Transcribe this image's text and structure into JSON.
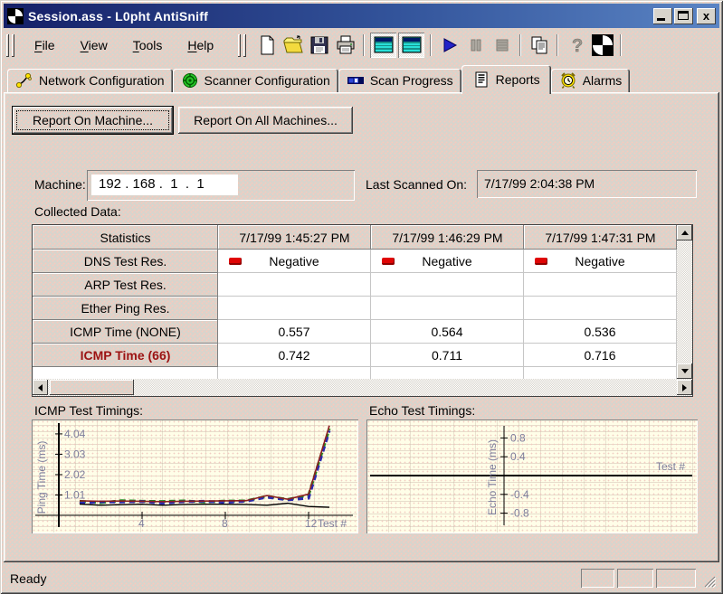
{
  "window": {
    "title": "Session.ass - L0pht AntiSniff",
    "status_ready": "Ready"
  },
  "titlebar": {
    "buttons": [
      "minimize",
      "maximize",
      "close"
    ]
  },
  "menu": {
    "items": [
      "File",
      "View",
      "Tools",
      "Help"
    ]
  },
  "toolbar": {
    "buttons": [
      "new-file",
      "open-file",
      "save-file",
      "print",
      "machine-view-left",
      "machine-view-right",
      "start-scan",
      "pause-scan",
      "stop-scan",
      "copy-report",
      "help",
      "l0pht-logo"
    ]
  },
  "tabs": [
    {
      "label": "Network Configuration",
      "icon": "network-icon",
      "active": false
    },
    {
      "label": "Scanner Configuration",
      "icon": "scanner-icon",
      "active": false
    },
    {
      "label": "Scan Progress",
      "icon": "progress-icon",
      "active": false
    },
    {
      "label": "Reports",
      "icon": "reports-icon",
      "active": true
    },
    {
      "label": "Alarms",
      "icon": "alarm-icon",
      "active": false
    }
  ],
  "reports_tab": {
    "report_on_machine": "Report On Machine...",
    "report_on_all": "Report On All Machines...",
    "machine_label": "Machine:",
    "machine_ip": "192 . 168 .  1  .  1",
    "last_scanned_label": "Last Scanned On:",
    "last_scanned_value": "7/17/99 2:04:38 PM",
    "collected_data_label": "Collected Data:"
  },
  "table": {
    "headers": [
      "Statistics",
      "7/17/99 1:45:27 PM",
      "7/17/99 1:46:29 PM",
      "7/17/99 1:47:31 PM"
    ],
    "rows": [
      {
        "label": "DNS Test Res.",
        "flag": true,
        "red": false,
        "cells": [
          "Negative",
          "Negative",
          "Negative"
        ]
      },
      {
        "label": "ARP Test Res.",
        "flag": false,
        "red": false,
        "cells": [
          "",
          "",
          ""
        ]
      },
      {
        "label": "Ether Ping Res.",
        "flag": false,
        "red": false,
        "cells": [
          "",
          "",
          ""
        ]
      },
      {
        "label": "ICMP Time (NONE)",
        "flag": false,
        "red": false,
        "cells": [
          "0.557",
          "0.564",
          "0.536"
        ]
      },
      {
        "label": "ICMP Time (66)",
        "flag": false,
        "red": true,
        "cells": [
          "0.742",
          "0.711",
          "0.716"
        ]
      }
    ]
  },
  "chart_data": [
    {
      "id": "icmp-chart",
      "type": "line",
      "title": "ICMP Test Timings:",
      "xlabel": "Test #",
      "ylabel": "Ping Time (ms)",
      "yticks": [
        1.01,
        2.02,
        3.03,
        4.04
      ],
      "xticks": [
        4,
        8,
        12
      ],
      "ylim": [
        0,
        4.8
      ],
      "x": [
        1,
        2,
        3,
        4,
        5,
        6,
        7,
        8,
        9,
        10,
        11,
        12,
        13
      ],
      "series": [
        {
          "name": "scan-series-green",
          "color": "#1f8c1f",
          "width": 3,
          "dash": "7 4",
          "values": [
            0.7,
            0.62,
            0.73,
            0.7,
            0.69,
            0.72,
            0.66,
            0.71,
            0.72,
            0.95,
            0.79,
            1.0,
            4.3
          ]
        },
        {
          "name": "scan-series-blue",
          "color": "#2a2aae",
          "width": 3,
          "dash": "6 5",
          "values": [
            0.6,
            0.67,
            0.66,
            0.69,
            0.6,
            0.68,
            0.7,
            0.64,
            0.7,
            0.9,
            0.77,
            0.85,
            4.2
          ]
        },
        {
          "name": "ICMP Time (66)",
          "color": "#8b1f1f",
          "width": 1.6,
          "dash": "",
          "values": [
            0.72,
            0.7,
            0.71,
            0.7,
            0.68,
            0.7,
            0.71,
            0.72,
            0.73,
            0.98,
            0.8,
            1.05,
            4.45
          ]
        },
        {
          "name": "ICMP Time (NONE)",
          "color": "#000000",
          "width": 1.4,
          "dash": "",
          "values": [
            0.56,
            0.5,
            0.53,
            0.55,
            0.5,
            0.54,
            0.55,
            0.55,
            0.54,
            0.5,
            0.6,
            0.44,
            0.4
          ]
        }
      ]
    },
    {
      "id": "echo-chart",
      "type": "line",
      "title": "Echo Test Timings:",
      "xlabel": "Test #",
      "ylabel": "Echo Time (ms)",
      "yticks": [
        0.8,
        0.4,
        -0.4,
        -0.8
      ],
      "xticks": [],
      "ylim": [
        -1,
        1
      ],
      "x": [],
      "series": []
    }
  ],
  "colors": {
    "titlebar_from": "#151f67",
    "titlebar_to": "#5a84c4",
    "face": "#d8d4cc",
    "dither_dot": "#f6cabe",
    "chart_bg": "#fffee8",
    "negative_flag": "#e00505",
    "red_row_text": "#9b1212",
    "tick_text": "#7d7d9c"
  }
}
